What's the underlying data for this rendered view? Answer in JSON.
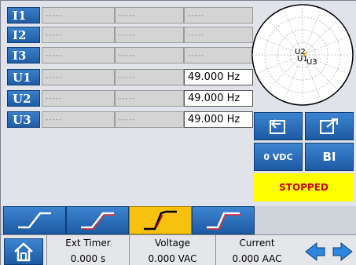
{
  "channels": [
    {
      "label": "I1",
      "col1": "-----",
      "col2": "-----",
      "col3": "-----"
    },
    {
      "label": "I2",
      "col1": "-----",
      "col2": "-----",
      "col3": "-----"
    },
    {
      "label": "I3",
      "col1": "-----",
      "col2": "-----",
      "col3": "-----"
    },
    {
      "label": "U1",
      "col1": "-----",
      "col2": "-----",
      "col3": "49.000 Hz"
    },
    {
      "label": "U2",
      "col1": "-----",
      "col2": "-----",
      "col3": "49.000 Hz"
    },
    {
      "label": "U3",
      "col1": "-----",
      "col2": "-----",
      "col3": "49.000 Hz"
    }
  ],
  "phasor": {
    "labels": [
      "U2",
      "U1",
      "U3"
    ]
  },
  "side": {
    "vdc_label": "0 VDC",
    "bi_label": "BI",
    "status": "STOPPED",
    "export_icon": "export-icon",
    "edit_icon": "edit-icon"
  },
  "tabs": [
    {
      "icon": "ramp-up-icon",
      "active": false
    },
    {
      "icon": "ramp-up-red-icon",
      "active": false
    },
    {
      "icon": "ramp-step-icon",
      "active": true
    },
    {
      "icon": "ramp-step-red-icon",
      "active": false
    }
  ],
  "bottom": {
    "home_icon": "home-icon",
    "ext_timer_label": "Ext Timer",
    "ext_timer_value": "0.000 s",
    "voltage_label": "Voltage",
    "voltage_value": "0.000 VAC",
    "current_label": "Current",
    "current_value": "0.000 AAC",
    "prev_icon": "arrow-left-icon",
    "next_icon": "arrow-right-icon"
  },
  "colors": {
    "accent_blue": "#1f5da6",
    "active_tab": "#f7c20f",
    "status_bg": "#ffff00",
    "status_text": "#d40000"
  }
}
